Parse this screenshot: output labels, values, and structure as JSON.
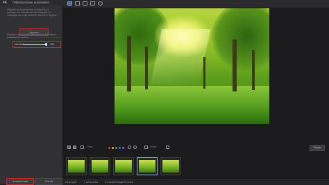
{
  "titlebar": {
    "brand": "4K",
    "panel_title": "Ottimizzazione automatica"
  },
  "left_panel": {
    "description": "Regolare automaticamente la luminosità, il contrasto e la saturazione della fotografia. Se l'immagine non è più uniforme, fare clic su Applica.",
    "apply_button": "Applica",
    "slider_help": "Regolare l'intensità dell'ottimizzazione automatica trascinando il cursore.",
    "slider_label": "Intensità",
    "slider_value": "100",
    "slider_level": 1.0,
    "undo_button": "Annulla tutto",
    "close_button": "Chiudi"
  },
  "toolbar": {
    "icons": [
      "image-icon",
      "gallery-icon",
      "grid-icon",
      "monitor-icon",
      "share-icon"
    ]
  },
  "film_toolbar": {
    "filter_label": "Filtro",
    "sort_label": "Ordina",
    "browse_button": "Sfoglia",
    "color_dots": [
      "#d33b2f",
      "#e8b52a",
      "#3fa34d",
      "#3b7fd8",
      "#a64fd6"
    ]
  },
  "filmstrip": {
    "thumbnails": [
      {
        "num": "1"
      },
      {
        "num": "2"
      },
      {
        "num": "3"
      },
      {
        "num": "4",
        "selected": true
      },
      {
        "num": "5"
      }
    ]
  },
  "status": {
    "count": "5 immagini",
    "selected": "1 selezionata",
    "path": "C:\\Utenti\\Immagini\\Foresta"
  }
}
